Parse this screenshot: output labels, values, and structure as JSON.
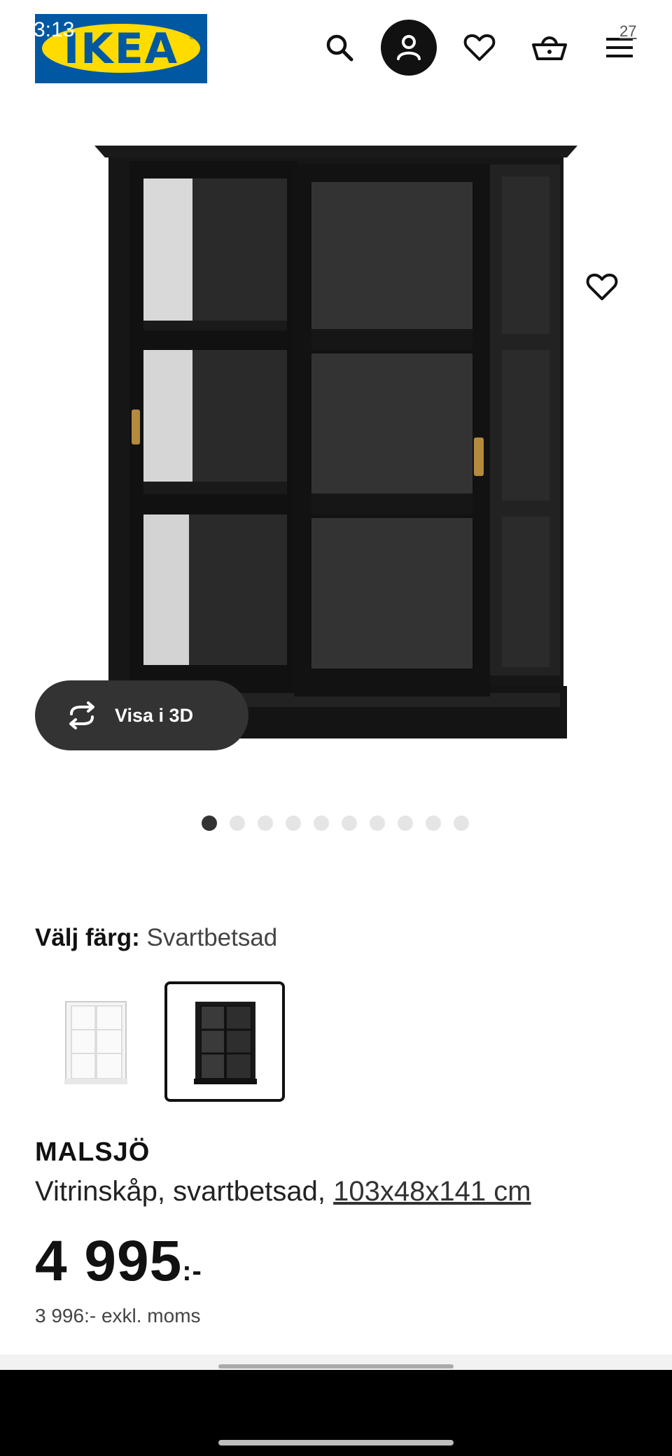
{
  "status": {
    "time": "3:13"
  },
  "header": {
    "logo_text": "IKEA",
    "icons": [
      "search-icon",
      "profile-icon",
      "heart-icon",
      "basket-icon",
      "menu-icon"
    ],
    "menu_badge": "27"
  },
  "gallery": {
    "view_3d_label": "Visa i 3D",
    "dot_count": 10,
    "active_dot": 1
  },
  "color_picker": {
    "label": "Välj färg:",
    "value": "Svartbetsad",
    "options": [
      {
        "name": "white",
        "selected": false
      },
      {
        "name": "black",
        "selected": true
      }
    ]
  },
  "product": {
    "name": "MALSJÖ",
    "description": "Vitrinskåp, svartbetsad, ",
    "dimensions": "103x48x141 cm",
    "price": "4 995",
    "price_suffix": ":-",
    "price_excl_vat": "3 996:- exkl. moms"
  },
  "colors": {
    "dark": "#111111",
    "ikea_blue": "#0058a3",
    "ikea_yellow": "#ffdb00",
    "pill": "#333333"
  }
}
